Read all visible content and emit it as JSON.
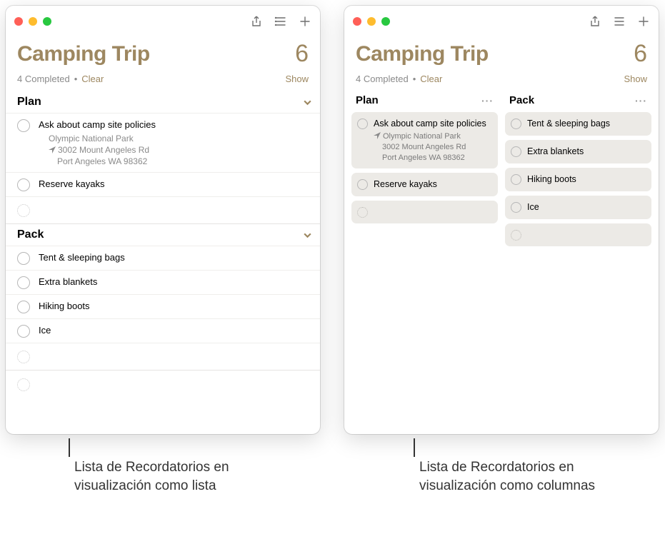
{
  "list_view": {
    "title": "Camping Trip",
    "count": "6",
    "completed_text": "4 Completed",
    "clear_label": "Clear",
    "show_label": "Show",
    "sections": {
      "plan": {
        "name": "Plan",
        "items": [
          {
            "title": "Ask about camp site policies",
            "loc_name": "Olympic National Park",
            "loc_addr1": "3002 Mount Angeles Rd",
            "loc_addr2": "Port Angeles WA 98362"
          },
          {
            "title": "Reserve kayaks"
          }
        ]
      },
      "pack": {
        "name": "Pack",
        "items": [
          {
            "title": "Tent & sleeping bags"
          },
          {
            "title": "Extra blankets"
          },
          {
            "title": "Hiking boots"
          },
          {
            "title": "Ice"
          }
        ]
      }
    }
  },
  "column_view": {
    "title": "Camping Trip",
    "count": "6",
    "completed_text": "4 Completed",
    "clear_label": "Clear",
    "show_label": "Show",
    "columns": {
      "plan": {
        "name": "Plan",
        "items": [
          {
            "title": "Ask about camp site policies",
            "loc_name": "Olympic National Park",
            "loc_addr1": "3002 Mount Angeles Rd",
            "loc_addr2": "Port Angeles WA 98362"
          },
          {
            "title": "Reserve kayaks"
          }
        ]
      },
      "pack": {
        "name": "Pack",
        "items": [
          {
            "title": "Tent & sleeping bags"
          },
          {
            "title": "Extra blankets"
          },
          {
            "title": "Hiking boots"
          },
          {
            "title": "Ice"
          }
        ]
      }
    }
  },
  "captions": {
    "left": "Lista de Recordatorios en visualización como lista",
    "right": "Lista de Recordatorios en visualización como columnas"
  }
}
